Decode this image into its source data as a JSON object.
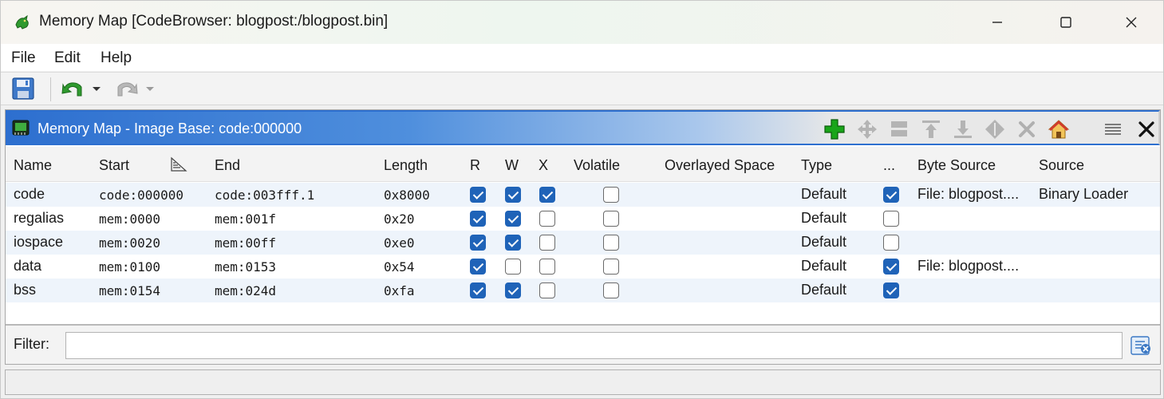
{
  "window": {
    "title": "Memory Map [CodeBrowser: blogpost:/blogpost.bin]",
    "controls": {
      "minimize": "minimize",
      "maximize": "maximize",
      "close": "close"
    }
  },
  "menubar": {
    "items": [
      "File",
      "Edit",
      "Help"
    ]
  },
  "toolbar": {
    "buttons": [
      "save-icon",
      "undo-icon",
      "redo-icon"
    ]
  },
  "panel": {
    "title": "Memory Map - Image Base: code:000000",
    "actions": [
      "add-block-icon",
      "move-block-icon",
      "split-block-icon",
      "expand-up-icon",
      "expand-down-icon",
      "merge-blocks-icon",
      "delete-block-icon",
      "set-image-base-icon",
      "table-menu-icon",
      "close-panel-icon"
    ],
    "colors": {
      "header_start": "#2d6fcf",
      "checkbox_on": "#1f63b8",
      "add_green": "#19a519"
    }
  },
  "table": {
    "columns": [
      "Name",
      "Start",
      "End",
      "Length",
      "R",
      "W",
      "X",
      "Volatile",
      "Overlayed Space",
      "Type",
      "...",
      "Byte Source",
      "Source"
    ],
    "rows": [
      {
        "name": "code",
        "start": "code:000000",
        "end": "code:003fff.1",
        "length": "0x8000",
        "r": true,
        "w": true,
        "x": true,
        "volatile": false,
        "overlayed": "",
        "type": "Default",
        "init": true,
        "byte_source": "File: blogpost....",
        "source": "Binary Loader"
      },
      {
        "name": "regalias",
        "start": "mem:0000",
        "end": "mem:001f",
        "length": "0x20",
        "r": true,
        "w": true,
        "x": false,
        "volatile": false,
        "overlayed": "",
        "type": "Default",
        "init": false,
        "byte_source": "",
        "source": ""
      },
      {
        "name": "iospace",
        "start": "mem:0020",
        "end": "mem:00ff",
        "length": "0xe0",
        "r": true,
        "w": true,
        "x": false,
        "volatile": false,
        "overlayed": "",
        "type": "Default",
        "init": false,
        "byte_source": "",
        "source": ""
      },
      {
        "name": "data",
        "start": "mem:0100",
        "end": "mem:0153",
        "length": "0x54",
        "r": true,
        "w": false,
        "x": false,
        "volatile": false,
        "overlayed": "",
        "type": "Default",
        "init": true,
        "byte_source": "File: blogpost....",
        "source": ""
      },
      {
        "name": "bss",
        "start": "mem:0154",
        "end": "mem:024d",
        "length": "0xfa",
        "r": true,
        "w": true,
        "x": false,
        "volatile": false,
        "overlayed": "",
        "type": "Default",
        "init": true,
        "byte_source": "",
        "source": ""
      }
    ]
  },
  "filter": {
    "label": "Filter:",
    "value": "",
    "placeholder": ""
  }
}
